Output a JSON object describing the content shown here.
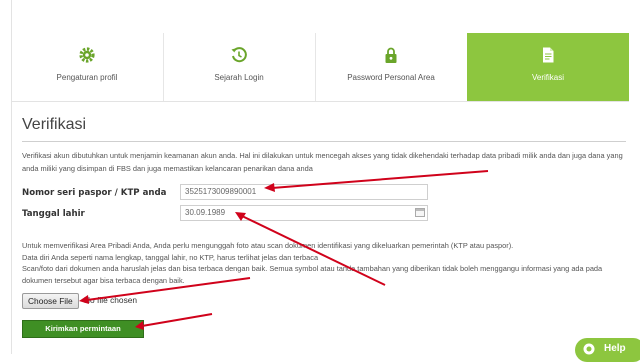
{
  "tabs": [
    {
      "label": "Pengaturan profil",
      "icon": "gear-icon"
    },
    {
      "label": "Sejarah Login",
      "icon": "history-icon"
    },
    {
      "label": "Password Personal Area",
      "icon": "lock-icon"
    },
    {
      "label": "Verifikasi",
      "icon": "document-icon"
    }
  ],
  "page_title": "Verifikasi",
  "intro_text": "Verifikasi akun dibutuhkan untuk menjamin keamanan akun anda. Hal ini dilakukan untuk mencegah akses yang tidak dikehendaki terhadap data pribadi milik anda dan juga dana yang anda miliki yang disimpan di FBS dan juga memastikan kelancaran penarikan dana anda",
  "fields": {
    "passport_label": "Nomor seri paspor / KTP anda",
    "passport_value": "3525173009890001",
    "birth_label": "Tanggal lahir",
    "birth_value": "30.09.1989"
  },
  "instructions": [
    "Untuk memverifikasi Area Pribadi Anda, Anda perlu mengunggah foto atau scan dokumen identifikasi yang dikeluarkan pemerintah (KTP atau paspor).",
    "Data diri Anda seperti nama lengkap, tanggal lahir, no KTP, harus terlihat jelas dan terbaca",
    "Scan/foto dari dokumen anda haruslah jelas dan bisa terbaca dengan baik. Semua symbol atau tanda tambahan yang diberikan tidak boleh menggangu informasi yang ada pada dokumen tersebut agar bisa terbaca dengan baik."
  ],
  "file": {
    "button": "Choose File",
    "status": "No file chosen"
  },
  "submit_label": "Kirimkan permintaan",
  "help_label": "Help",
  "colors": {
    "accent": "#8dc63f",
    "submit": "#3f8f24",
    "annotation": "#d0021b"
  }
}
